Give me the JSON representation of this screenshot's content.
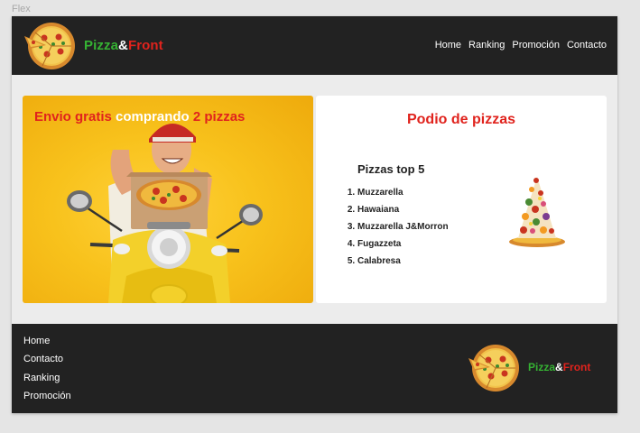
{
  "frame_label": "Flex",
  "brand": {
    "part1": "Pizza",
    "part2": "&",
    "part3": "Front"
  },
  "nav": [
    "Home",
    "Ranking",
    "Promoción",
    "Contacto"
  ],
  "promo": {
    "part1": "Envio gratis ",
    "part2": "comprando ",
    "part3": "2 pizzas"
  },
  "podium": {
    "title": "Podio de pizzas",
    "list_title": "Pizzas top 5",
    "items": [
      "Muzzarella",
      "Hawaiana",
      "Muzzarella J&Morron",
      "Fugazzeta",
      "Calabresa"
    ]
  },
  "footer": {
    "links": [
      "Home",
      "Contacto",
      "Ranking",
      "Promoción"
    ]
  },
  "colors": {
    "green": "#35b233",
    "red": "#e0231d",
    "dark": "#222222",
    "yellow": "#f8c21c"
  }
}
